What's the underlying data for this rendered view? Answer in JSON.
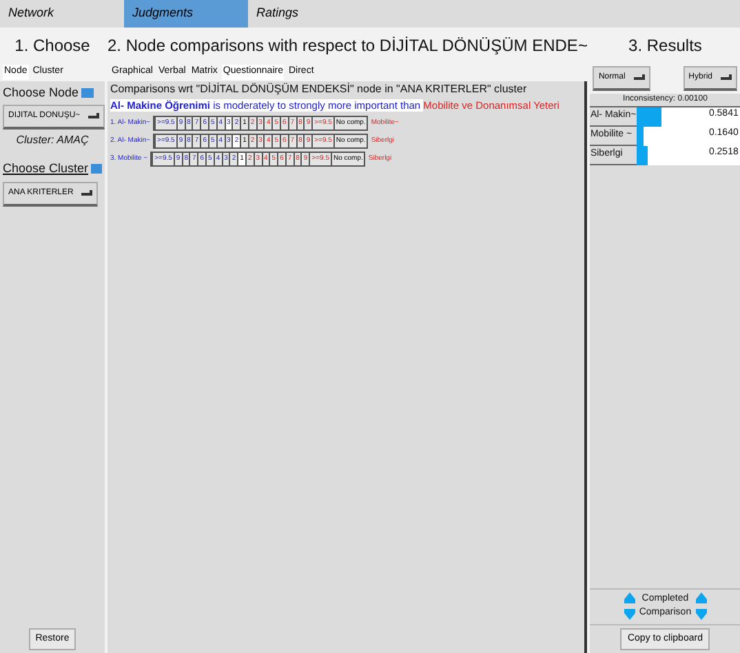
{
  "menu": [
    {
      "label": "Network",
      "selected": false
    },
    {
      "label": "Judgments",
      "selected": true
    },
    {
      "label": "Ratings",
      "selected": false
    }
  ],
  "choose": {
    "title": "1. Choose",
    "tabs": [
      {
        "label": "Node",
        "selected": true
      },
      {
        "label": "Cluster",
        "selected": false
      }
    ],
    "choose_node": "Choose Node",
    "node_value": "DIJITAL DONUŞU~",
    "cluster_label": "Cluster: AMAÇ",
    "choose_cluster": "Choose Cluster",
    "cluster_value": "ANA KRITERLER",
    "restore": "Restore"
  },
  "comparisons": {
    "title": "2. Node comparisons with respect to DİJİTAL DÖNÜŞÜM ENDE~",
    "tabs": [
      {
        "label": "Graphical",
        "selected": false
      },
      {
        "label": "Verbal",
        "selected": false
      },
      {
        "label": "Matrix",
        "selected": false
      },
      {
        "label": "Questionnaire",
        "selected": true
      },
      {
        "label": "Direct",
        "selected": false
      }
    ],
    "heading": "Comparisons wrt \"DİJİTAL DÖNÜŞÜM ENDEKSİ\" node in \"ANA KRITERLER\" cluster",
    "verbal": {
      "subject": "Al- Makine Öğrenimi",
      "phrase": " is moderately to strongly more important than ",
      "object": "Mobilite ve Donanımsal Yeteri"
    },
    "rows": [
      {
        "left": "1. Al- Makin~",
        "right": "Mobilite~",
        "cells": [
          {
            "label": ">=9.5",
            "selected": false
          },
          {
            "label": "9",
            "selected": false
          },
          {
            "label": "8",
            "selected": false
          },
          {
            "label": "7",
            "selected": false
          },
          {
            "label": "6",
            "selected": false
          },
          {
            "label": "5",
            "selected": false
          },
          {
            "label": "4",
            "selected": false
          },
          {
            "label": "3",
            "selected": true
          },
          {
            "label": "2",
            "selected": false
          },
          {
            "label": "1",
            "selected": false
          },
          {
            "label": "2",
            "selected": false
          },
          {
            "label": "3",
            "selected": false
          },
          {
            "label": "4",
            "selected": false
          },
          {
            "label": "5",
            "selected": false
          },
          {
            "label": "6",
            "selected": false
          },
          {
            "label": "7",
            "selected": false
          },
          {
            "label": "8",
            "selected": false
          },
          {
            "label": "9",
            "selected": false
          },
          {
            "label": ">=9.5",
            "selected": false
          },
          {
            "label": "No comp.",
            "selected": false
          }
        ]
      },
      {
        "left": "2. Al- Makin~",
        "right": "Siberlgi",
        "cells": [
          {
            "label": ">=9.5",
            "selected": false
          },
          {
            "label": "9",
            "selected": false
          },
          {
            "label": "8",
            "selected": false
          },
          {
            "label": "7",
            "selected": false
          },
          {
            "label": "6",
            "selected": false
          },
          {
            "label": "5",
            "selected": false
          },
          {
            "label": "4",
            "selected": false
          },
          {
            "label": "3",
            "selected": false
          },
          {
            "label": "2",
            "selected": true
          },
          {
            "label": "1",
            "selected": false
          },
          {
            "label": "2",
            "selected": false
          },
          {
            "label": "3",
            "selected": false
          },
          {
            "label": "4",
            "selected": false
          },
          {
            "label": "5",
            "selected": false
          },
          {
            "label": "6",
            "selected": false
          },
          {
            "label": "7",
            "selected": false
          },
          {
            "label": "8",
            "selected": false
          },
          {
            "label": "9",
            "selected": false
          },
          {
            "label": ">=9.5",
            "selected": false
          },
          {
            "label": "No comp.",
            "selected": false
          }
        ]
      },
      {
        "left": "3. Mobilite ~",
        "right": "Siberlgi",
        "cells": [
          {
            "label": ">=9.5",
            "selected": false
          },
          {
            "label": "9",
            "selected": false
          },
          {
            "label": "8",
            "selected": false
          },
          {
            "label": "7",
            "selected": false
          },
          {
            "label": "6",
            "selected": false
          },
          {
            "label": "5",
            "selected": false
          },
          {
            "label": "4",
            "selected": false
          },
          {
            "label": "3",
            "selected": false
          },
          {
            "label": "2",
            "selected": false
          },
          {
            "label": "1",
            "selected": true
          },
          {
            "label": "2",
            "selected": false
          },
          {
            "label": "3",
            "selected": false
          },
          {
            "label": "4",
            "selected": false
          },
          {
            "label": "5",
            "selected": false
          },
          {
            "label": "6",
            "selected": false
          },
          {
            "label": "7",
            "selected": false
          },
          {
            "label": "8",
            "selected": false
          },
          {
            "label": "9",
            "selected": false
          },
          {
            "label": ">=9.5",
            "selected": false
          },
          {
            "label": "No comp.",
            "selected": false
          }
        ]
      }
    ]
  },
  "results": {
    "title": "3. Results",
    "mode": "Normal",
    "method": "Hybrid",
    "inconsistency": "Inconsistency: 0.00100",
    "rows": [
      {
        "name": "Al- Makin~",
        "level": 0.35,
        "value": "0.5841"
      },
      {
        "name": "Mobilite ~",
        "level": 0.1,
        "value": "0.1640"
      },
      {
        "name": "Siberlgi",
        "level": 0.15,
        "value": "0.2518"
      }
    ],
    "completed": "Completed Comparison",
    "copy": "Copy to clipboard"
  }
}
